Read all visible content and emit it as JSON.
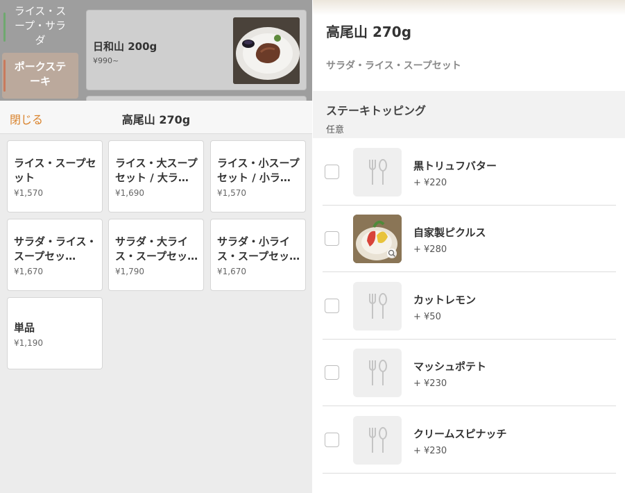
{
  "left": {
    "categories": [
      {
        "label": "ライス・ス\nープ・サラ\nダ"
      },
      {
        "label": "ポークステ\nーキ"
      }
    ],
    "menu_item": {
      "name": "日和山 200g",
      "price": "¥990~"
    },
    "sheet": {
      "close_label": "閉じる",
      "title": "高尾山 270g",
      "options": [
        {
          "title": "ライス・スープセット",
          "price": "¥1,570"
        },
        {
          "title": "ライス・大スープセット / 大ラ…",
          "price": "¥1,690"
        },
        {
          "title": "ライス・小スープセット / 小ラ…",
          "price": "¥1,570"
        },
        {
          "title": "サラダ・ライス・スープセッ…",
          "price": "¥1,670"
        },
        {
          "title": "サラダ・大ライス・スープセッ…",
          "price": "¥1,790"
        },
        {
          "title": "サラダ・小ライス・スープセッ…",
          "price": "¥1,670"
        },
        {
          "title": "単品",
          "price": "¥1,190"
        }
      ]
    }
  },
  "right": {
    "title": "高尾山 270g",
    "subtitle": "サラダ・ライス・スープセット",
    "group": {
      "title": "ステーキトッピング",
      "requirement": "任意",
      "items": [
        {
          "name": "黒トリュフバター",
          "price": "+ ¥220",
          "icon": "utensils-icon",
          "checked": false
        },
        {
          "name": "自家製ピクルス",
          "price": "+ ¥280",
          "icon": "pickles-photo",
          "checked": false
        },
        {
          "name": "カットレモン",
          "price": "+ ¥50",
          "icon": "utensils-icon",
          "checked": false
        },
        {
          "name": "マッシュポテト",
          "price": "+ ¥230",
          "icon": "utensils-icon",
          "checked": false
        },
        {
          "name": "クリームスピナッチ",
          "price": "+ ¥230",
          "icon": "utensils-icon",
          "checked": false
        }
      ]
    }
  },
  "colors": {
    "accent": "#d9822b",
    "card_border": "#d6d6d6",
    "panel_bg": "#ececec"
  }
}
